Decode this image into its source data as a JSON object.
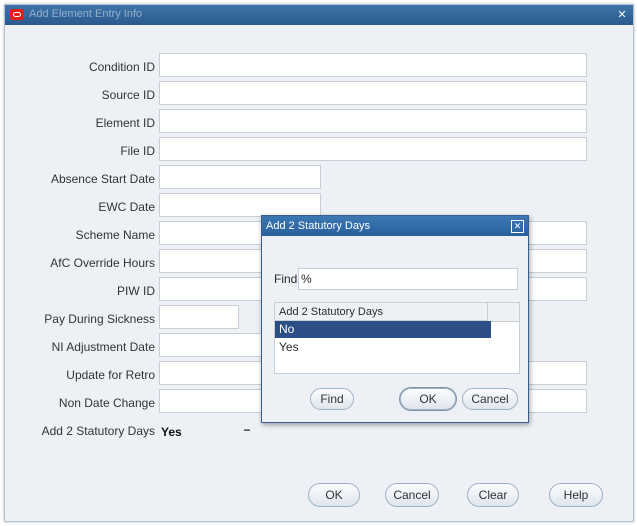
{
  "window": {
    "title": "Add Element Entry Info"
  },
  "form": {
    "fields": [
      {
        "label": "Condition ID"
      },
      {
        "label": "Source ID"
      },
      {
        "label": "Element ID"
      },
      {
        "label": "File ID"
      },
      {
        "label": "Absence Start Date"
      },
      {
        "label": "EWC Date"
      },
      {
        "label": "Scheme Name"
      },
      {
        "label": "AfC Override Hours"
      },
      {
        "label": "PIW ID"
      },
      {
        "label": "Pay During Sickness"
      },
      {
        "label": "NI Adjustment Date"
      },
      {
        "label": "Update for Retro"
      },
      {
        "label": "Non Date Change"
      },
      {
        "label": "Add 2 Statutory Days",
        "value": "Yes"
      }
    ],
    "lov_button_label": "−"
  },
  "buttons": {
    "ok": "OK",
    "cancel": "Cancel",
    "clear": "Clear",
    "help": "Help"
  },
  "dialog": {
    "title": "Add 2 Statutory Days",
    "find_label": "Find",
    "find_value": "%",
    "column_header": "Add 2 Statutory Days",
    "options": [
      "No",
      "Yes"
    ],
    "selected": "No",
    "buttons": {
      "find": "Find",
      "ok": "OK",
      "cancel": "Cancel"
    }
  }
}
